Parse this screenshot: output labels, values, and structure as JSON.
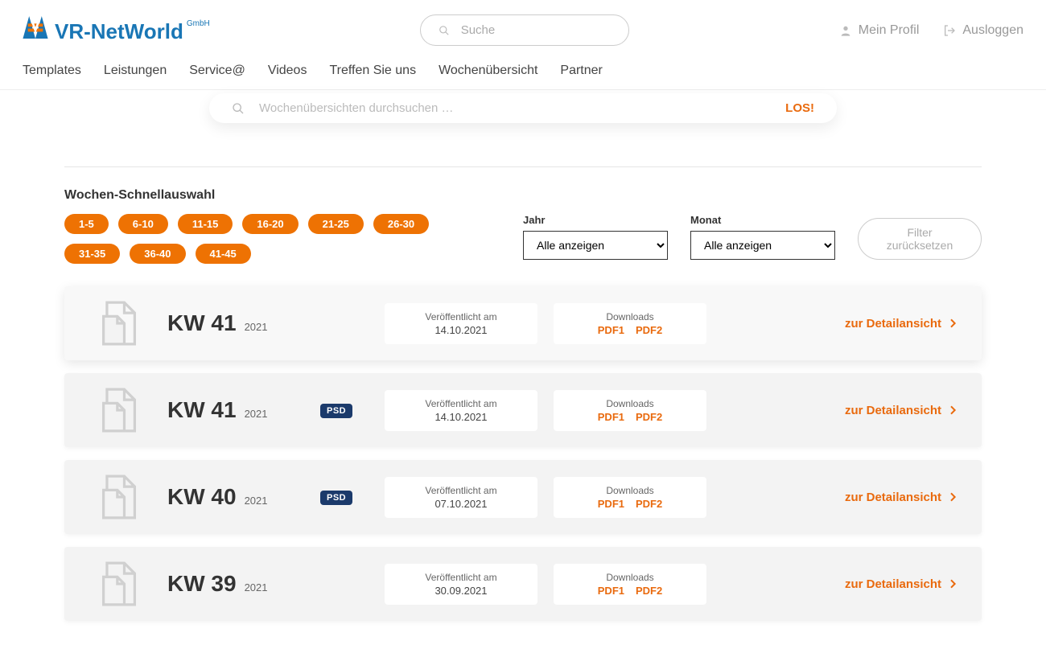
{
  "brand": {
    "name": "VR-NetWorld",
    "suffix": "GmbH"
  },
  "header": {
    "search_placeholder": "Suche",
    "profile": "Mein Profil",
    "logout": "Ausloggen"
  },
  "nav": [
    "Templates",
    "Leistungen",
    "Service@",
    "Videos",
    "Treffen Sie uns",
    "Wochenübersicht",
    "Partner"
  ],
  "page_search": {
    "placeholder": "Wochenübersichten durchsuchen …",
    "go": "LOS!"
  },
  "quick_select": {
    "title": "Wochen-Schnellauswahl",
    "ranges": [
      "1-5",
      "6-10",
      "11-15",
      "16-20",
      "21-25",
      "26-30",
      "31-35",
      "36-40",
      "41-45"
    ]
  },
  "filters": {
    "year_label": "Jahr",
    "month_label": "Monat",
    "all_option": "Alle anzeigen",
    "reset": "Filter zurücksetzen"
  },
  "labels": {
    "published": "Veröffentlicht am",
    "downloads": "Downloads",
    "detail": "zur Detailansicht",
    "pdf1": "PDF1",
    "pdf2": "PDF2",
    "psd": "PSD"
  },
  "rows": [
    {
      "kw": "KW 41",
      "year": "2021",
      "psd": false,
      "published": "14.10.2021"
    },
    {
      "kw": "KW 41",
      "year": "2021",
      "psd": true,
      "published": "14.10.2021"
    },
    {
      "kw": "KW 40",
      "year": "2021",
      "psd": true,
      "published": "07.10.2021"
    },
    {
      "kw": "KW 39",
      "year": "2021",
      "psd": false,
      "published": "30.09.2021"
    }
  ]
}
